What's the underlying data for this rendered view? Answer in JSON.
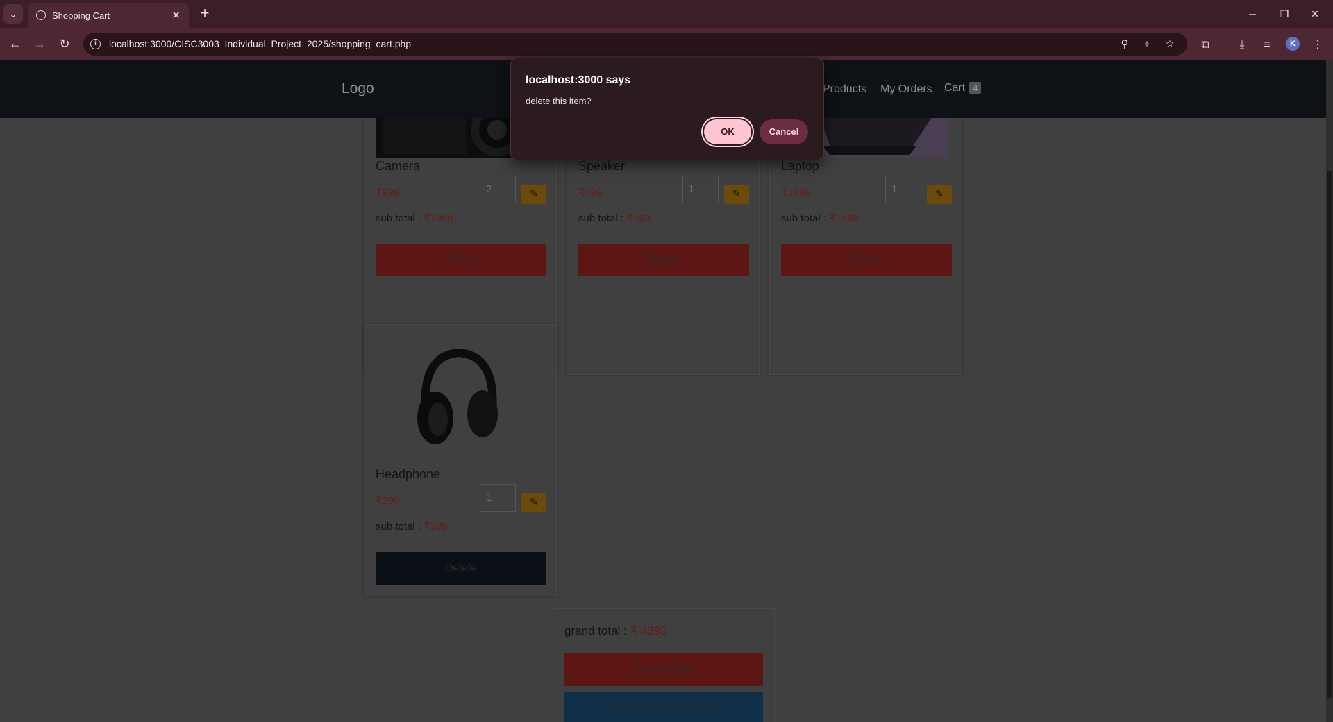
{
  "browser": {
    "tab_title": "Shopping Cart",
    "url": "localhost:3000/CISC3003_Individual_Project_2025/shopping_cart.php",
    "profile_initial": "K"
  },
  "site": {
    "logo": "Logo",
    "nav": {
      "products": "Products",
      "orders": "My Orders",
      "cart": "Cart",
      "cart_count": "4"
    }
  },
  "currency": "₹",
  "cart": {
    "subtotal_label": "sub total :",
    "delete_label": "Delete",
    "items": [
      {
        "name": "Camera",
        "price": "999",
        "qty": "2",
        "subtotal": "1998"
      },
      {
        "name": "Speaker",
        "price": "499",
        "qty": "1",
        "subtotal": "499"
      },
      {
        "name": "Laptop",
        "price": "1499",
        "qty": "1",
        "subtotal": "1499"
      },
      {
        "name": "Headphone",
        "price": "399",
        "qty": "1",
        "subtotal": "399"
      }
    ]
  },
  "summary": {
    "grand_total_label": "grand total :",
    "grand_total": "4395",
    "empty_cart": "Empty Cart",
    "checkout": "Proceed To Checkout"
  },
  "dialog": {
    "title": "localhost:3000 says",
    "message": "delete this item?",
    "ok": "OK",
    "cancel": "Cancel"
  },
  "colors": {
    "delete_button": "#5c1714",
    "headphone_delete_button": "#0b1016",
    "checkout_button": "#0f3048",
    "dialog_ok": "#ffc6d2",
    "dialog_cancel": "#6d2c41"
  }
}
